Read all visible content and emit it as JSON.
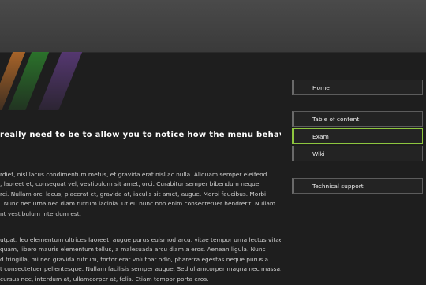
{
  "heading": "really need to be to allow you to notice how the menu behave when it",
  "paragraph1": [
    "rdiet, nisl lacus condimentum metus, et gravida erat nisl ac nulla. Aliquam semper eleifend",
    ", laoreet et, consequat vel, vestibulum sit amet, orci. Curabitur semper bibendum neque.",
    "rci. Nullam orci lacus, placerat et, gravida at, iaculis sit amet, augue. Morbi faucibus. Morbi",
    ". Nunc nec urna nec diam rutrum lacinia. Ut eu nunc non enim consectetuer hendrerit. Nullam",
    "nt vestibulum interdum est."
  ],
  "paragraph2": [
    "utpat, leo elementum ultrices laoreet, augue purus euismod arcu, vitae tempor urna lectus vitae",
    "quam, libero mauris elementum tellus, a malesuada arcu diam a eros. Aenean ligula. Nunc",
    "d fringilla, mi nec gravida rutrum, tortor erat volutpat odio, pharetra egestas neque purus a",
    "t consectetuer pellentesque. Nullam facilisis semper augue. Sed ullamcorper magna nec massa.",
    "cursus nec, interdum at, ullamcorper at, felis. Etiam tempor porta eros."
  ],
  "nav": {
    "home": "Home",
    "toc": "Table of content",
    "exam": "Exam",
    "wiki": "Wiki",
    "support": "Technical support"
  },
  "colors": {
    "accent": "#8ec63f",
    "background": "#1e1e1e",
    "topbar": "#444444"
  }
}
